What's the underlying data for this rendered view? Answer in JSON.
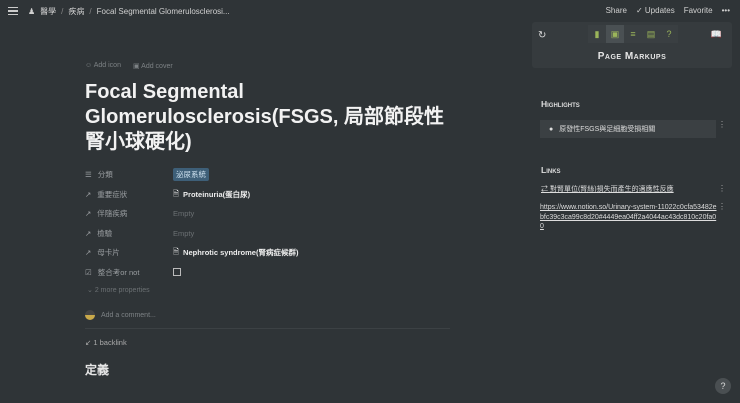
{
  "breadcrumb": {
    "items": [
      "醫學",
      "疾病",
      "Focal Segmental Glomerulosclerosi..."
    ]
  },
  "header_actions": {
    "share": "Share",
    "updates": "Updates",
    "favorite": "Favorite",
    "more": "•••"
  },
  "page": {
    "add_icon": "Add icon",
    "add_cover": "Add cover",
    "title": "Focal Segmental Glomerulosclerosis(FSGS, 局部節段性腎小球硬化)",
    "properties": [
      {
        "name": "分類",
        "value": "泌尿系統",
        "type": "tag"
      },
      {
        "name": "重要症狀",
        "value": "Proteinuria(蛋白尿)",
        "type": "relation"
      },
      {
        "name": "伴隨疾病",
        "value": "Empty",
        "type": "empty"
      },
      {
        "name": "檢驗",
        "value": "Empty",
        "type": "empty"
      },
      {
        "name": "母卡片",
        "value": "Nephrotic syndrome(腎病症候群)",
        "type": "relation"
      },
      {
        "name": "整合考or not",
        "value": false,
        "type": "checkbox"
      }
    ],
    "more_properties": "2 more properties",
    "add_comment": "Add a comment...",
    "backlink": "1 backlink",
    "heading": "定義"
  },
  "panel": {
    "title": "Page Markups",
    "highlights_label": "Highlights",
    "highlight": "原發性FSGS與足細胞受損相關",
    "links_label": "Links",
    "link_text": "對腎單位(腎絲)損失而產生的適應性反應",
    "link_url": "https://www.notion.so/Urinary-system-11022c0cfa53482ebfc39c3ca99c8d20#4449ea04ff2a4044ac43dc810c20fa00"
  },
  "help": "?"
}
